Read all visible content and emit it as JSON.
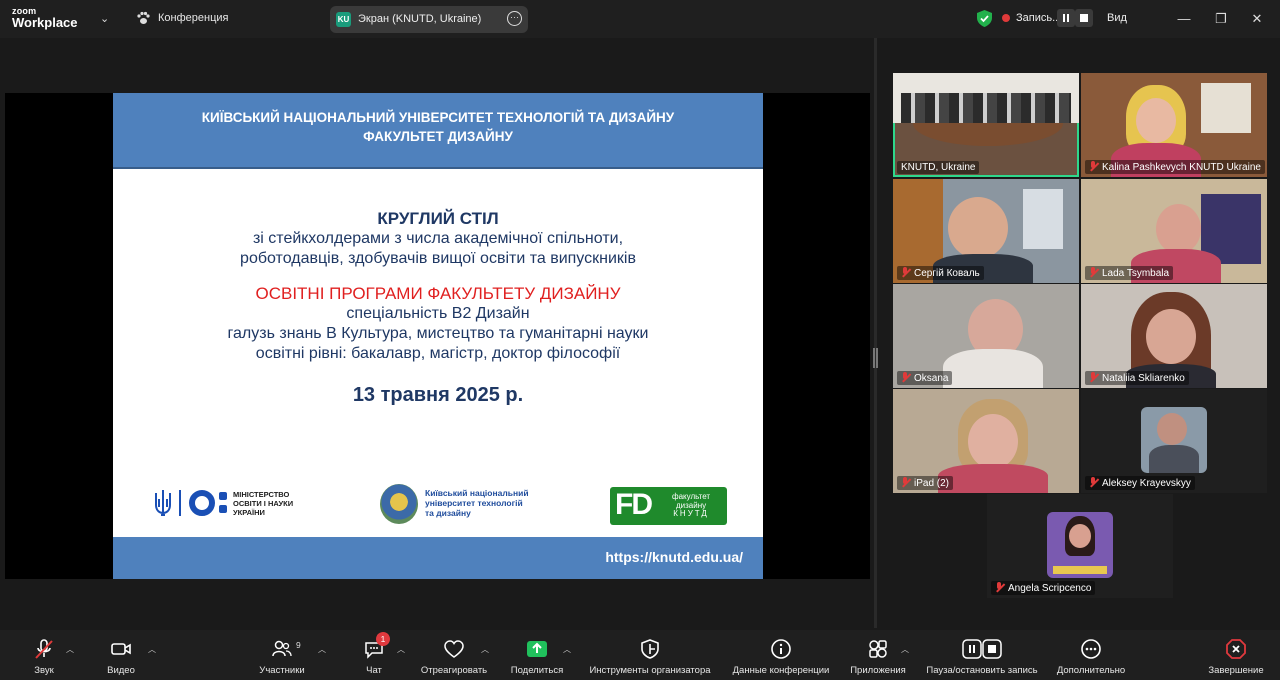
{
  "topbar": {
    "logo_line1": "zoom",
    "logo_line2": "Workplace",
    "meeting_title": "Конференция",
    "share_badge": "KU",
    "share_title": "Экран (KNUTD, Ukraine)",
    "record_label": "Запись...",
    "view_label": "Вид"
  },
  "slide": {
    "header_line1": "КИЇВСЬКИЙ НАЦІОНАЛЬНИЙ УНІВЕРСИТЕТ  ТЕХНОЛОГІЙ ТА ДИЗАЙНУ",
    "header_line2": "ФАКУЛЬТЕТ  ДИЗАЙНУ",
    "title": "КРУГЛИЙ СТІЛ",
    "line1": "зі стейкхолдерами з числа академічної спільноти,",
    "line2": "роботодавців, здобувачів вищої освіти та випускників",
    "red_title": "ОСВІТНІ ПРОГРАМИ ФАКУЛЬТЕТУ ДИЗАЙНУ",
    "line3": "спеціальність В2 Дизайн",
    "line4": "галузь знань В Культура, мистецтво та гуманітарні науки",
    "line5": "освітні рівні: бакалавр, магістр, доктор філософії",
    "date": "13 травня  2025 р.",
    "ministry_line1": "МІНІСТЕРСТВО",
    "ministry_line2": "ОСВІТИ І НАУКИ",
    "ministry_line3": "УКРАЇНИ",
    "knutd_line1": "Київський національний",
    "knutd_line2": "університет технологій",
    "knutd_line3": "та дизайну",
    "fd_mark": "FD",
    "fd_line1": "факультет",
    "fd_line2": "дизайну",
    "fd_line3": "КНУТД",
    "url": "https://knutd.edu.ua/"
  },
  "participants": [
    {
      "name": "KNUTD, Ukraine",
      "muted": false
    },
    {
      "name": "Kalina Pashkevych KNUTD Ukraine",
      "muted": true
    },
    {
      "name": "Сергій Коваль",
      "muted": true
    },
    {
      "name": "Lada Tsymbala",
      "muted": true
    },
    {
      "name": "Oksana",
      "muted": true
    },
    {
      "name": "Nataliia Skliarenko",
      "muted": true
    },
    {
      "name": "iPad (2)",
      "muted": true
    },
    {
      "name": "Aleksey Krayevskyy",
      "muted": true
    },
    {
      "name": "Angela Scripcenco",
      "muted": true
    }
  ],
  "toolbar": {
    "audio": "Звук",
    "video": "Видео",
    "participants": "Участники",
    "participants_count": "9",
    "chat": "Чат",
    "chat_badge": "1",
    "react": "Отреагировать",
    "share": "Поделиться",
    "host_tools": "Инструменты организатора",
    "meeting_info": "Данные конференции",
    "apps": "Приложения",
    "record": "Пауза/остановить запись",
    "more": "Дополнительно",
    "end": "Завершение"
  },
  "colors": {
    "slide_header": "#4f81bd",
    "slide_red": "#e02020",
    "slide_text": "#1f3864",
    "active_speaker": "#2fd88c",
    "share_green": "#20c05c",
    "end_red": "#e0393e"
  }
}
